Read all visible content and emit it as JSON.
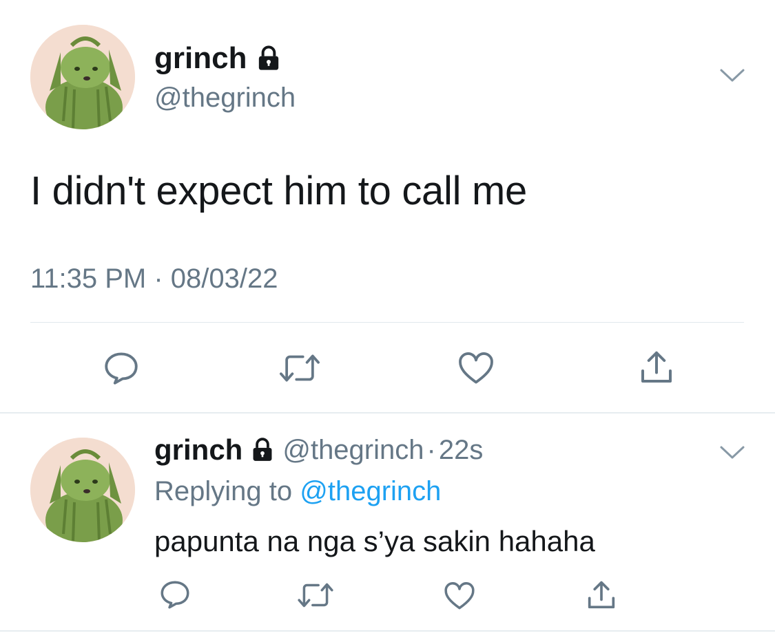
{
  "tweet": {
    "display_name": "grinch",
    "handle": "@thegrinch",
    "text": "I didn't expect him to call me",
    "timestamp": "11:35 PM · 08/03/22",
    "avatar_icon": "green-dog-avatar",
    "locked_icon": "lock-icon",
    "menu_icon": "chevron-down-icon"
  },
  "actions": {
    "reply_icon": "reply-icon",
    "retweet_icon": "retweet-icon",
    "like_icon": "heart-icon",
    "share_icon": "share-icon"
  },
  "reply": {
    "display_name": "grinch",
    "handle": "@thegrinch",
    "separator": "·",
    "time": "22s",
    "replying_prefix": "Replying to",
    "replying_to": "@thegrinch",
    "text": "papunta na nga s’ya sakin hahaha"
  },
  "colors": {
    "text": "#14171a",
    "secondary": "#657786",
    "link": "#1da1f2",
    "divider": "#e1e8ed"
  }
}
